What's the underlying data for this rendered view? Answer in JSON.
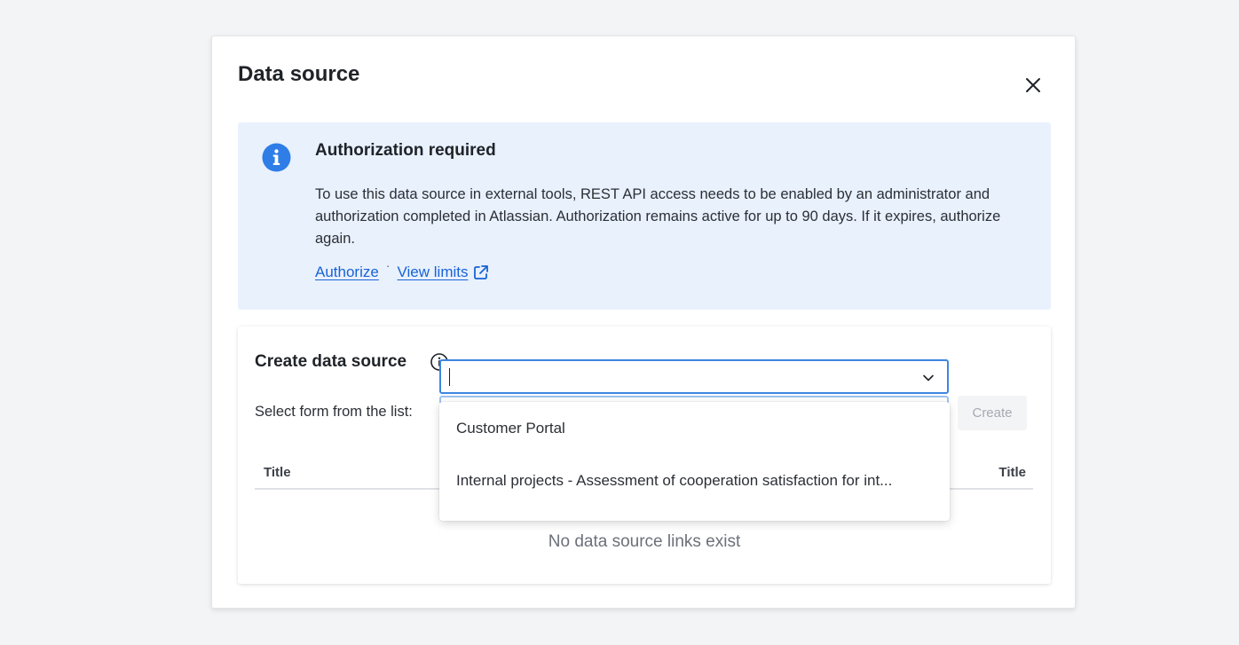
{
  "modal": {
    "title": "Data source"
  },
  "banner": {
    "title": "Authorization required",
    "body": "To use this data source in external tools, REST API access needs to be enabled by an administrator and authorization completed in Atlassian. Authorization remains active for up to 90 days. If it expires, authorize again.",
    "links": {
      "authorize": "Authorize",
      "separator": "·",
      "view_limits": "View limits"
    },
    "icon": "info-icon",
    "accent_color": "#2f7de6",
    "background_color": "#e9f1fd"
  },
  "create": {
    "title": "Create data source",
    "select_label": "Select form from the list:",
    "create_label": "Create",
    "combobox": {
      "value": "",
      "options": [
        "Customer Portal",
        "Internal projects - Assessment of cooperation satisfaction for int..."
      ]
    },
    "table": {
      "columns": [
        "Title",
        "Title"
      ],
      "empty_message": "No data source links exist"
    }
  },
  "colors": {
    "link": "#1863d6",
    "focus_border": "#3d86e0"
  }
}
